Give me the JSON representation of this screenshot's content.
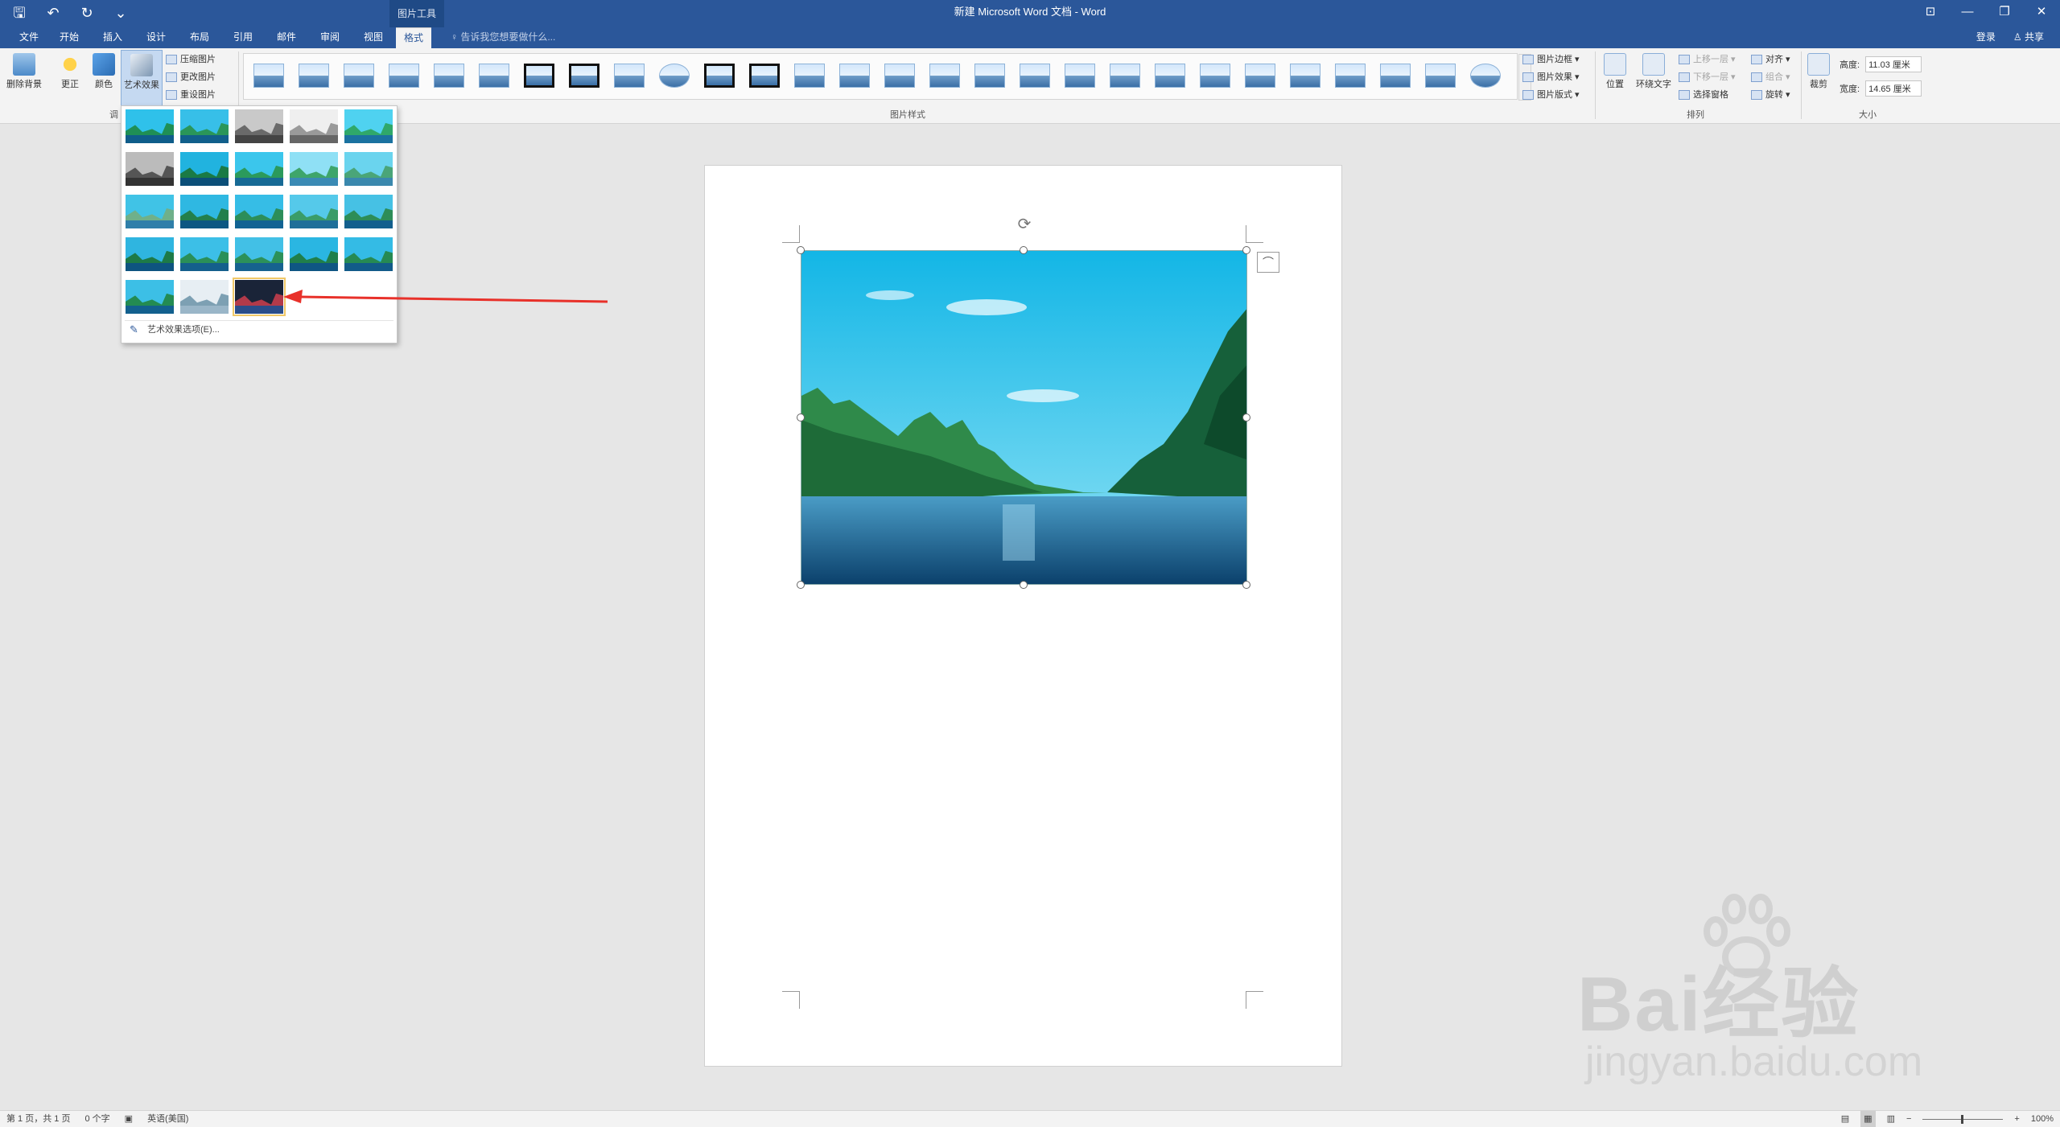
{
  "titlebar": {
    "title": "新建 Microsoft Word 文档 - Word",
    "context_tab": "图片工具",
    "qat": [
      "🖫",
      "↶",
      "↻",
      "⌄"
    ],
    "window_controls": [
      "⊡",
      "—",
      "❐",
      "✕"
    ]
  },
  "tabs": {
    "items": [
      "文件",
      "开始",
      "插入",
      "设计",
      "布局",
      "引用",
      "邮件",
      "审阅",
      "视图",
      "格式"
    ],
    "active": "格式",
    "tell_me": "♀ 告诉我您想要做什么...",
    "login": "登录",
    "share": "♙ 共享"
  },
  "ribbon": {
    "adjust": {
      "remove_bg": "删除背景",
      "corrections": "更正",
      "color": "颜色",
      "artistic": "艺术效果",
      "compress": "压缩图片",
      "change": "更改图片",
      "reset": "重设图片",
      "group_label": "调"
    },
    "styles": {
      "group_label": "图片样式",
      "border": "图片边框 ▾",
      "effects": "图片效果 ▾",
      "layout": "图片版式 ▾"
    },
    "arrange": {
      "group_label": "排列",
      "position": "位置",
      "wrap": "环绕文字",
      "forward": "上移一层 ▾",
      "backward": "下移一层 ▾",
      "selection_pane": "选择窗格",
      "align": "对齐 ▾",
      "group": "组合 ▾",
      "rotate": "旋转 ▾"
    },
    "size": {
      "group_label": "大小",
      "crop": "裁剪",
      "height_label": "高度:",
      "height_value": "11.03 厘米",
      "width_label": "宽度:",
      "width_value": "14.65 厘米"
    }
  },
  "artistic_panel": {
    "options_label": "艺术效果选项(E)...",
    "selected_index": 22
  },
  "statusbar": {
    "page": "第 1 页，共 1 页",
    "words": "0 个字",
    "lang": "英语(美国)",
    "zoom": "100%"
  },
  "watermark": {
    "brand": "Bai经验",
    "url": "jingyan.baidu.com"
  }
}
